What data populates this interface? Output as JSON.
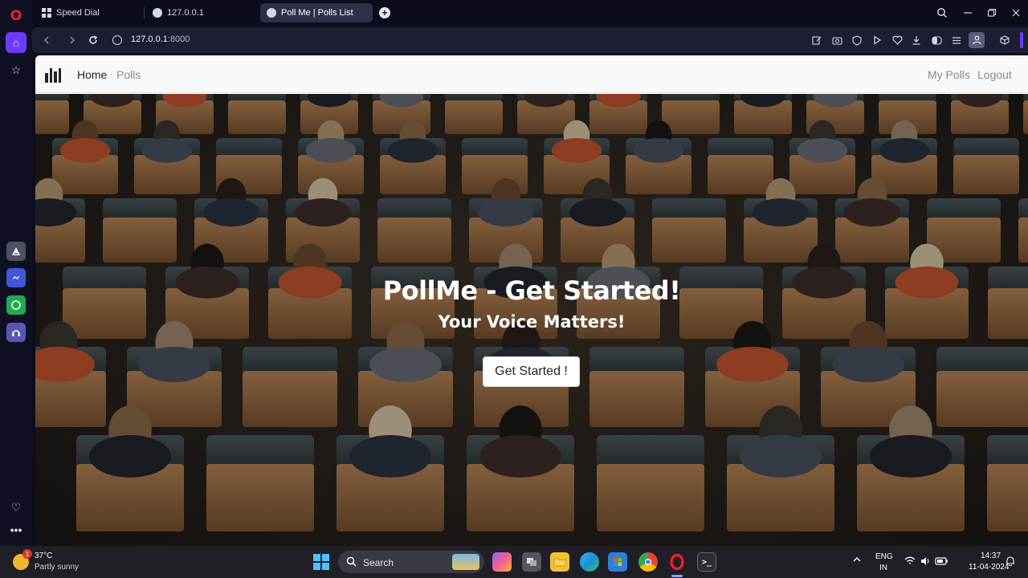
{
  "browser": {
    "tabs": [
      {
        "label": "Speed Dial"
      },
      {
        "label": "127.0.0.1"
      },
      {
        "label": "Poll Me | Polls List"
      }
    ],
    "new_tab_label": "+",
    "url_host": "127.0.0.1",
    "url_port": ":8000",
    "accent_color": "#6b3cff"
  },
  "sidebar": {
    "logo_glyph": "O",
    "home_icon": "⌂",
    "star_icon": "☆",
    "heart_icon": "♡",
    "more_icon": "•••"
  },
  "site": {
    "nav": {
      "home": "Home",
      "polls": "Polls",
      "my_polls": "My Polls",
      "logout": "Logout"
    },
    "hero": {
      "title": "PollMe - Get Started!",
      "subtitle": "Your Voice Matters!",
      "button": "Get Started !"
    }
  },
  "taskbar": {
    "weather_badge": "1",
    "temperature": "37°C",
    "condition": "Partly sunny",
    "search_label": "Search",
    "lang_line1": "ENG",
    "lang_line2": "IN",
    "time": "14:37",
    "date": "11-04-2024"
  }
}
